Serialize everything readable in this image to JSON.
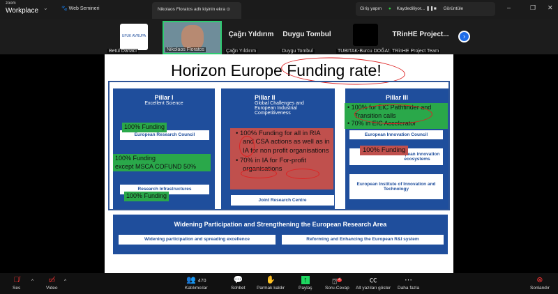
{
  "app": {
    "brand_top": "zoom",
    "brand": "Workplace",
    "webinar": "Web Semineri",
    "tab_title": "Nikolaos Floratos adlı kişinin ekra",
    "sign_in": "Giriş yapın",
    "recording": "Kaydediliyor...",
    "view": "Görüntüle"
  },
  "participants": [
    {
      "name": "Betül Danacı",
      "display": "logo",
      "logo_text": "UFUK AVRUPA"
    },
    {
      "name": "Nikolaos Floratos",
      "display": "video"
    },
    {
      "name": "Çağrı Yıldırım",
      "display": "Çağrı Yıldırım"
    },
    {
      "name": "Duygu Tombul",
      "display": "Duygu Tombul"
    },
    {
      "name": "TUBITAK-Burcu DOĞAN",
      "display": "black"
    },
    {
      "name": "TRinHE Project Team",
      "display": "TRinHE Project..."
    }
  ],
  "slide": {
    "title_a": "Horizon Europe ",
    "title_b": "Funding rate!",
    "pillar1": {
      "title": "Pillar I",
      "subtitle": "Excellent Science",
      "boxes": [
        "European Research Council",
        "Research Infrastructures"
      ],
      "notes": [
        "100% Funding",
        "100% Funding",
        "except MSCA COFUND 50%",
        "100% Funding"
      ]
    },
    "pillar2": {
      "title": "Pillar II",
      "subtitle": "Global Challenges and European Industrial Competitiveness",
      "boxes": [
        "Joint Research Centre"
      ],
      "notes": [
        "100% Funding for all in RIA and CSA actions as well as in IA for non profit organisations",
        "70% in IA for For-profit organisations"
      ]
    },
    "pillar3": {
      "title": "Pillar III",
      "boxes": [
        "European Innovation Council",
        "European innovation ecosystems",
        "European Institute of Innovation and Technology"
      ],
      "notes": [
        "100% for EIC Pathfinder and Transition calls",
        "70% in EIC Accelerator",
        "100% Funding"
      ]
    },
    "widening": {
      "title": "Widening Participation and Strengthening the European Research Area",
      "boxes": [
        "Widening participation and spreading excellence",
        "Reforming and Enhancing the European R&I system"
      ]
    }
  },
  "toolbar": {
    "audio": "Ses",
    "video": "Video",
    "participants": "Katılımcılar",
    "participant_count": "470",
    "chat": "Sohbet",
    "raise_hand": "Parmak kaldır",
    "share": "Paylaş",
    "qa": "Soru-Cevap",
    "qa_badge": "4",
    "captions": "Alt yazıları göster",
    "more": "Daha fazla",
    "end": "Sonlandır"
  },
  "colors": {
    "accent_green": "#2aa84a",
    "share_green": "#1ed760",
    "end_red": "#e02828",
    "pillar_blue": "#1f4e9c"
  }
}
